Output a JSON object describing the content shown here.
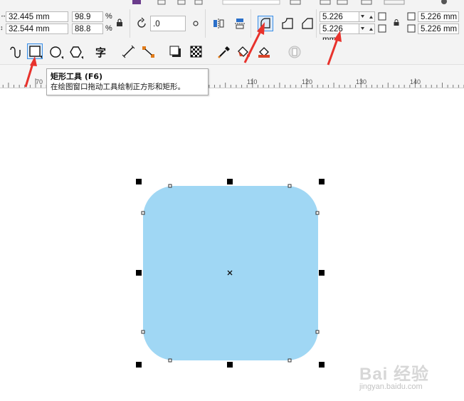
{
  "propbar": {
    "x_position": "32.445 mm",
    "y_position": "32.544 mm",
    "scale_x": "98.9",
    "scale_y": "88.8",
    "percent_symbol": "%",
    "rotation": ".0",
    "corner_radius_top_left": "5.226 mm",
    "corner_radius_bottom_left": "5.226 mm",
    "corner_radius_top_right": "5.226 mm",
    "corner_radius_bottom_right": "5.226 mm"
  },
  "toolbox": {
    "text_tool_glyph": "字",
    "selected_tool": "rectangle-tool"
  },
  "ruler": {
    "labels": [
      "70",
      "110",
      "120",
      "130",
      "140"
    ]
  },
  "tooltip": {
    "title": "矩形工具 (F6)",
    "description": "在绘图窗口拖动工具绘制正方形和矩形。"
  },
  "canvas": {
    "shape": "rounded-rectangle",
    "fill_color": "#a0d7f4"
  },
  "annotation_color": "#e8322c",
  "watermark": {
    "main": "Bai 经验",
    "sub": "jingyan.baidu.com"
  }
}
